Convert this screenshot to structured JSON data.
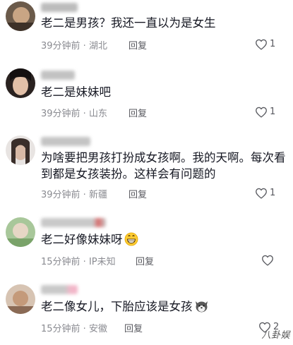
{
  "comments": [
    {
      "text": "老二是男孩？我还一直以为是女生",
      "time": "39分钟前",
      "location": "湖北",
      "reply_label": "回复",
      "likes": "1",
      "liked": false
    },
    {
      "text": "老二是妹妹吧",
      "time": "39分钟前",
      "location": "山东",
      "reply_label": "回复",
      "likes": "1",
      "liked": false
    },
    {
      "text": "为啥要把男孩打扮成女孩啊。我的天啊。每次看到都是女孩装扮。这样会有问题的",
      "time": "39分钟前",
      "location": "新疆",
      "reply_label": "回复",
      "likes": "1",
      "liked": false
    },
    {
      "text": "老二好像妹妹呀",
      "emoji": "grinning-face-icon",
      "time": "15分钟前",
      "location": "IP未知",
      "reply_label": "回复",
      "likes": "",
      "liked": false
    },
    {
      "text": "老二像女儿，下胎应该是女孩",
      "emoji": "dog-face-icon",
      "time": "15分钟前",
      "location": "安徽",
      "reply_label": "回复",
      "likes": "2",
      "liked": false
    }
  ],
  "separator": " · ",
  "watermark": "八卦娱",
  "colors": {
    "text": "#161823",
    "meta": "#8a8b91",
    "reply": "#58595f"
  }
}
